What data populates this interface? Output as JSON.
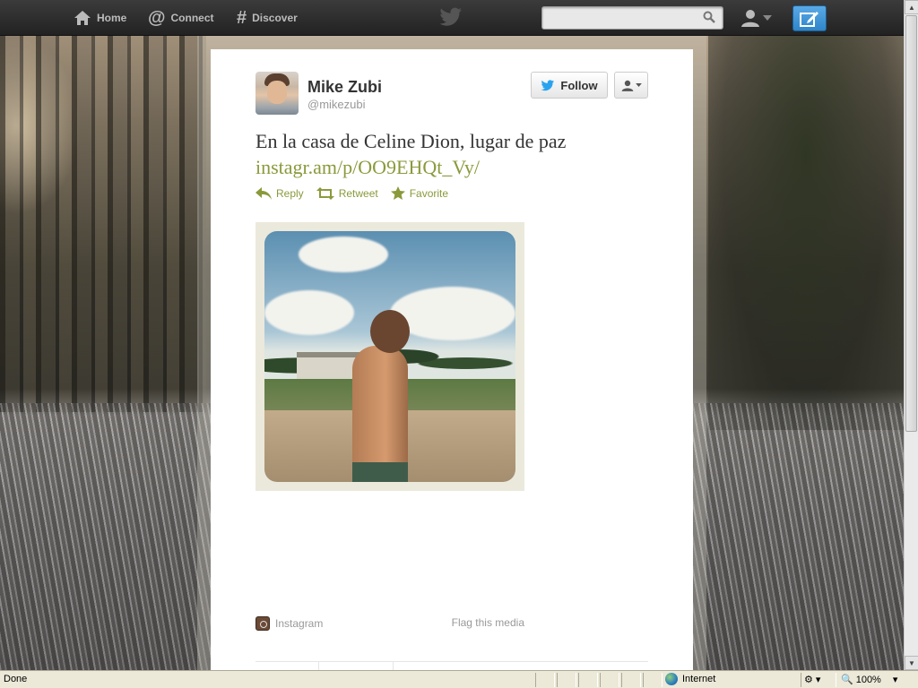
{
  "nav": {
    "home_label": "Home",
    "connect_label": "Connect",
    "discover_label": "Discover",
    "search_placeholder": ""
  },
  "tweet": {
    "full_name": "Mike Zubi",
    "screen_name": "@mikezubi",
    "follow_label": "Follow",
    "text": "En la casa de Celine Dion, lugar de paz",
    "link": "instagr.am/p/OO9EHQt_Vy/",
    "actions": {
      "reply": "Reply",
      "retweet": "Retweet",
      "favorite": "Favorite"
    }
  },
  "media": {
    "source_label": "Instagram",
    "flag_label": "Flag this media"
  },
  "status_bar": {
    "status": "Done",
    "zone": "Internet",
    "zoom": "100%"
  },
  "colors": {
    "link_accent": "#8a9a3b",
    "compose_blue": "#2f86c9",
    "twitter_blue": "#1da1f2"
  }
}
